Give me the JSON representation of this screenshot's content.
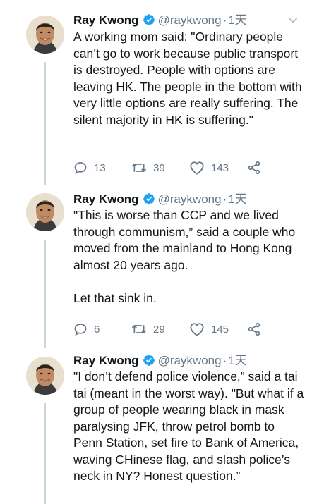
{
  "author": {
    "name": "Ray Kwong",
    "handle": "@raykwong",
    "separator": "·"
  },
  "tweets": [
    {
      "time": "1天",
      "text": "A working mom said: \"Ordinary people can’t go to work because public transport is destroyed. People with options are leaving HK. The people in the bottom with very little options are really suffering. The silent majority in HK is suffering.\"",
      "text2": "",
      "replies": "13",
      "retweets": "39",
      "likes": "143"
    },
    {
      "time": "1天",
      "text": "\"This is worse than CCP and we lived through communism,” said a couple who moved from the mainland to Hong Kong almost 20 years ago.",
      "text2": "Let that sink in.",
      "replies": "6",
      "retweets": "29",
      "likes": "145"
    },
    {
      "time": "1天",
      "text": "\"I don’t defend police violence,” said a tai tai (meant in the worst way). \"But what if a group of people wearing black in mask paralysing JFK, throw petrol bomb to Penn Station, set fire to Bank of America, waving CHinese flag, and slash police’s neck in NY? Honest question.”",
      "text2": ""
    }
  ],
  "colors": {
    "text": "#14171a",
    "secondary": "#657786",
    "verified": "#1da1f2",
    "thread_line": "#ccd6dd"
  },
  "icons": [
    "avatar-photo",
    "verified-badge-icon",
    "chevron-down-icon",
    "reply-icon",
    "retweet-icon",
    "like-icon",
    "share-icon"
  ]
}
